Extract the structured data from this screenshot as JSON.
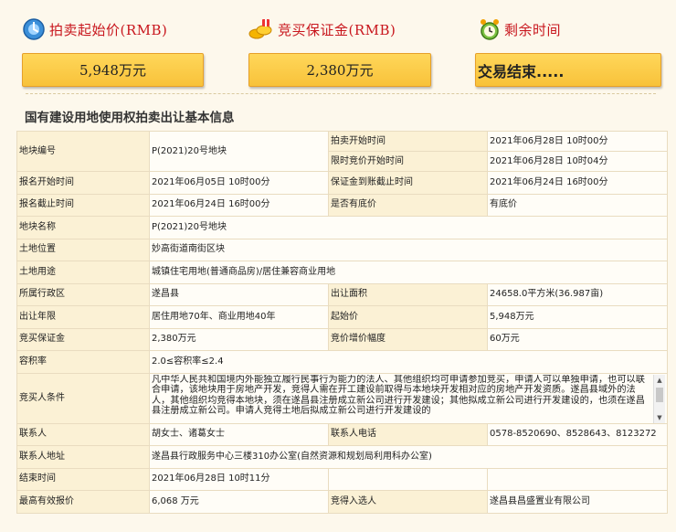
{
  "header": {
    "start_price_label": "拍卖起始价(RMB)",
    "deposit_label": "竞买保证金(RMB)",
    "time_left_label": "剩余时间",
    "start_price_value": "5,948万元",
    "deposit_value": "2,380万元",
    "time_left_value": "交易结束....."
  },
  "section_title": "国有建设用地使用权拍卖出让基本信息",
  "rows": {
    "parcel_no_key": "地块编号",
    "parcel_no_val": "P(2021)20号地块",
    "auction_start_key": "拍卖开始时间",
    "auction_start_val": "2021年06月28日 10时00分",
    "limited_bid_start_key": "限时竞价开始时间",
    "limited_bid_start_val": "2021年06月28日 10时04分",
    "reg_start_key": "报名开始时间",
    "reg_start_val": "2021年06月05日 10时00分",
    "deposit_deadline_key": "保证金到账截止时间",
    "deposit_deadline_val": "2021年06月24日 16时00分",
    "reg_end_key": "报名截止时间",
    "reg_end_val": "2021年06月24日 16时00分",
    "reserve_key": "是否有底价",
    "reserve_val": "有底价",
    "parcel_name_key": "地块名称",
    "parcel_name_val": "P(2021)20号地块",
    "location_key": "土地位置",
    "location_val": "妙高街道南街区块",
    "usage_key": "土地用途",
    "usage_val": "城镇住宅用地(普通商品房)/居住兼容商业用地",
    "district_key": "所属行政区",
    "district_val": "遂昌县",
    "area_key": "出让面积",
    "area_val": "24658.0平方米(36.987亩)",
    "term_key": "出让年限",
    "term_val": "居住用地70年、商业用地40年",
    "start_price_key": "起始价",
    "start_price_val": "5,948万元",
    "bid_deposit_key": "竞买保证金",
    "bid_deposit_val": "2,380万元",
    "increment_key": "竞价增价幅度",
    "increment_val": "60万元",
    "far_key": "容积率",
    "far_val": "2.0≤容积率≤2.4",
    "conditions_key": "竞买人条件",
    "conditions_val": "凡中华人民共和国境内外能独立履行民事行为能力的法人、其他组织均可申请参加竞买，申请人可以单独申请，也可以联合申请，该地块用于房地产开发，竞得人需在开工建设前取得与本地块开发相对应的房地产开发资质。遂昌县域外的法人，其他组织均竞得本地块，须在遂昌县注册成立新公司进行开发建设；其他拟成立新公司进行开发建设的，也须在遂昌县注册成立新公司。申请人竞得土地后拟成立新公司进行开发建设的",
    "contact_key": "联系人",
    "contact_val": "胡女士、诸葛女士",
    "phone_key": "联系人电话",
    "phone_val": "0578-8520690、8528643、8123272",
    "address_key": "联系人地址",
    "address_val": "遂昌县行政服务中心三楼310办公室(自然资源和规划局利用科办公室)",
    "end_time_key": "结束时间",
    "end_time_val": "2021年06月28日 10时11分",
    "top_bid_key": "最高有效报价",
    "top_bid_val": "6,068 万元",
    "winner_key": "竞得入选人",
    "winner_val": "遂昌县昌盛置业有限公司"
  },
  "colors": {
    "accent_red": "#c8161d",
    "box_yellow": "#f8c23a",
    "key_bg": "#fbf1d5"
  }
}
